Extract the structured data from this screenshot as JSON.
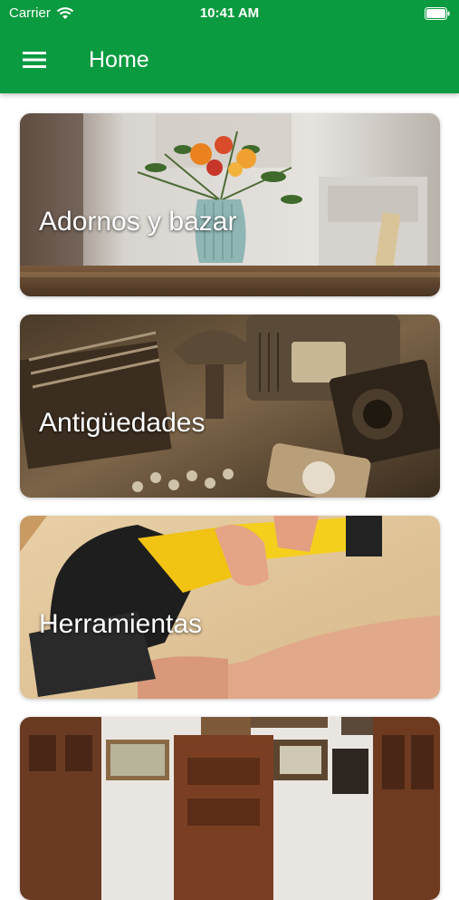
{
  "status_bar": {
    "carrier": "Carrier",
    "time": "10:41 AM"
  },
  "colors": {
    "primary": "#0a9a3f"
  },
  "toolbar": {
    "menu_icon": "hamburger-menu-icon",
    "title": "Home"
  },
  "categories": [
    {
      "label": "Adornos y bazar",
      "image": "vase-with-flowers"
    },
    {
      "label": "Antigüedades",
      "image": "vintage-typewriter-radio-camera"
    },
    {
      "label": "Herramientas",
      "image": "power-sander-on-wood"
    },
    {
      "label": "",
      "image": "antique-furniture-room"
    }
  ]
}
